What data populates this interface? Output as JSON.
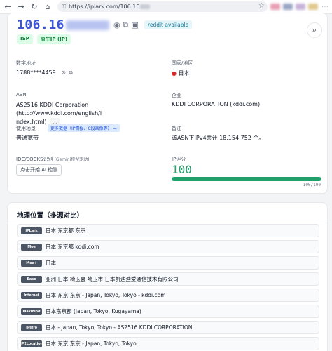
{
  "browser": {
    "url_prefix": "https://iplark.com/106.16",
    "back_icon": "arrow-left",
    "forward_icon": "arrow-right",
    "reload_icon": "reload",
    "home_icon": "home",
    "lock_icon": "lock",
    "star_icon": "star"
  },
  "ip_card": {
    "ip_prefix": "106.16",
    "reddit_badge": "reddit available",
    "tags": [
      "ISP",
      "原生IP (JP)"
    ],
    "fields": {
      "number_label": "数字地址",
      "number_value": "1788****4459",
      "country_label": "国家/地区",
      "country_flag": "●",
      "country_value": "日本",
      "asn_label": "ASN",
      "asn_value_line1": "AS2516 KDDI Corporation (http://www.kddi.com/english/i",
      "asn_value_line2": "ndex.html)",
      "asn_more": "...",
      "org_label": "企业",
      "org_value": "KDDI CORPORATION (kddi.com)",
      "usage_label": "使用场景",
      "usage_badge": "更多数据（IP情报、C段画像等） →",
      "usage_value": "普通宽带",
      "remark_label": "备注",
      "remark_value": "该ASN下IPv4共计 18,154,752 个。",
      "idc_label": "IDC/SOCKS识别",
      "idc_note": "(Gemini模型驱动)",
      "ai_button": "点击开始 AI 检测",
      "score_label": "IP评分",
      "score_value": "100",
      "score_max": "100/100",
      "score_fraction": 1.0
    }
  },
  "geo": {
    "title": "地理位置（多源对比）",
    "rows": [
      {
        "source": "IPLark",
        "text": "日本 东京都 东京"
      },
      {
        "source": "Moe",
        "text": "日本 东京都 kddi.com"
      },
      {
        "source": "Moe+",
        "text": "日本"
      },
      {
        "source": "Ease",
        "text": "亚洲 日本 埼玉县 埼玉市 日本凯迪迪爱通信技术有限公司"
      },
      {
        "source": "Internet",
        "text": "日本 东京 东京 - Japan, Tokyo, Tokyo - kddi.com"
      },
      {
        "source": "Maxmind",
        "text": "日本东京都 (Japan, Tokyo, Kugayama)"
      },
      {
        "source": "IPinfo",
        "text": "日本 - Japan, Tokyo, Tokyo - AS2516 KDDI CORPORATION"
      },
      {
        "source": "IP2Location",
        "text": "日本 东京 东京 -  Japan, Tokyo, Tokyo"
      }
    ]
  }
}
